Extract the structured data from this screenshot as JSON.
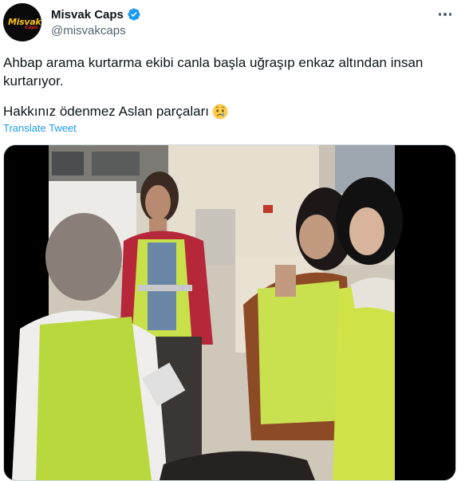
{
  "author": {
    "display_name": "Misvak Caps",
    "handle": "@misvakcaps",
    "avatar_text_main": "Misvak",
    "avatar_text_sub": "Caps",
    "verified": true
  },
  "tweet": {
    "paragraph1": "Ahbap arama kurtarma ekibi canla başla uğraşıp enkaz altından insan kurtarıyor.",
    "paragraph2": "Hakkınız ödenmez Aslan parçaları",
    "emoji": "crying-face",
    "translate_label": "Translate Tweet"
  },
  "media": {
    "type": "video-thumbnail"
  },
  "colors": {
    "accent": "#1d9bf0",
    "text": "#0f1419",
    "secondary": "#536471"
  }
}
